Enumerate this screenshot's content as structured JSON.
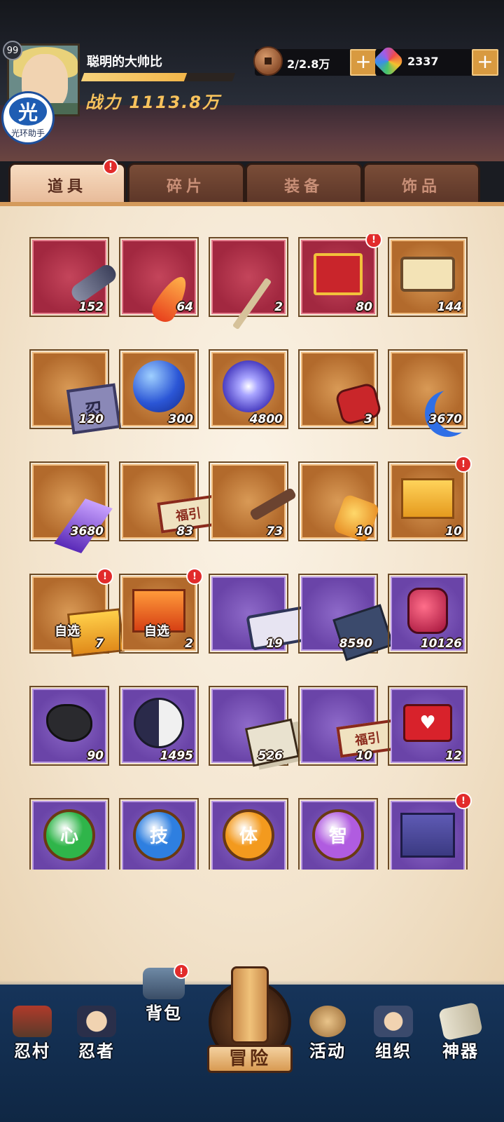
{
  "player": {
    "level": "99",
    "name": "聪明的大帅比",
    "power_label": "战力",
    "power_value": "1113.8万",
    "exp_fraction": 0.68
  },
  "helper_badge": {
    "glyph": "光",
    "label": "光环助手"
  },
  "resources": {
    "coins": {
      "icon": "copper-coin-icon",
      "value": "2/2.8万",
      "add": "+"
    },
    "gems": {
      "icon": "rainbow-gem-icon",
      "value": "2337",
      "add": "+"
    }
  },
  "tabs": [
    {
      "label": "道具",
      "active": true,
      "badge": "!"
    },
    {
      "label": "碎片",
      "active": false
    },
    {
      "label": "装备",
      "active": false
    },
    {
      "label": "饰品",
      "active": false
    }
  ],
  "items": [
    {
      "icon": "scroll-icon",
      "rarity": "red",
      "count": "152"
    },
    {
      "icon": "phoenix-feather-icon",
      "rarity": "red",
      "count": "64"
    },
    {
      "icon": "wooden-stick-icon",
      "rarity": "red",
      "count": "2"
    },
    {
      "icon": "gift-box-icon",
      "rarity": "red",
      "count": "80",
      "badge": "!"
    },
    {
      "icon": "map-scroll-icon",
      "rarity": "orange",
      "count": "144"
    },
    {
      "icon": "cloth-charm-icon",
      "rarity": "orange",
      "count": "120",
      "glyph": "忍"
    },
    {
      "icon": "blue-orb-icon",
      "rarity": "orange",
      "count": "300"
    },
    {
      "icon": "purple-orb-icon",
      "rarity": "orange",
      "count": "4800"
    },
    {
      "icon": "red-stone-icon",
      "rarity": "orange",
      "count": "3"
    },
    {
      "icon": "blue-moon-icon",
      "rarity": "orange",
      "count": "3670"
    },
    {
      "icon": "purple-crystal-icon",
      "rarity": "orange",
      "count": "3680"
    },
    {
      "icon": "fortune-banner-icon",
      "rarity": "orange",
      "count": "83",
      "glyph": "福引"
    },
    {
      "icon": "key-icon",
      "rarity": "orange",
      "count": "73"
    },
    {
      "icon": "amber-icon",
      "rarity": "orange",
      "count": "10"
    },
    {
      "icon": "gold-box-icon",
      "rarity": "orange",
      "count": "10",
      "badge": "!"
    },
    {
      "icon": "gold-chest-icon",
      "rarity": "orange",
      "count": "7",
      "tag": "自选",
      "badge": "!"
    },
    {
      "icon": "orange-chest-icon",
      "rarity": "orange",
      "count": "2",
      "tag": "自选",
      "badge": "!"
    },
    {
      "icon": "scroll-purple-icon",
      "rarity": "purple",
      "count": "19"
    },
    {
      "icon": "book-icon",
      "rarity": "purple",
      "count": "8590"
    },
    {
      "icon": "potion-jar-icon",
      "rarity": "purple",
      "count": "10126"
    },
    {
      "icon": "black-ore-icon",
      "rarity": "purple",
      "count": "90"
    },
    {
      "icon": "yin-yang-icon",
      "rarity": "purple",
      "count": "1495"
    },
    {
      "icon": "cards-icon",
      "rarity": "purple",
      "count": "526"
    },
    {
      "icon": "fortune-banner-icon",
      "rarity": "purple",
      "count": "10",
      "glyph": "福引"
    },
    {
      "icon": "medkit-icon",
      "rarity": "purple",
      "count": "12"
    },
    {
      "icon": "green-orb-icon",
      "rarity": "purple",
      "glyph": "心",
      "color": "#2fb54a"
    },
    {
      "icon": "blue-orb-icon",
      "rarity": "purple",
      "glyph": "技",
      "color": "#2e7fe0"
    },
    {
      "icon": "orange-orb-icon",
      "rarity": "purple",
      "glyph": "体",
      "color": "#f39a1e"
    },
    {
      "icon": "violet-orb-icon",
      "rarity": "purple",
      "glyph": "智",
      "color": "#b05ce0"
    },
    {
      "icon": "purple-box-icon",
      "rarity": "purple",
      "badge": "!"
    }
  ],
  "nav": [
    {
      "label": "忍村",
      "icon": "village-gate-icon"
    },
    {
      "label": "忍者",
      "icon": "ninja-icon"
    },
    {
      "label": "背包",
      "icon": "backpack-icon",
      "badge": "!"
    },
    {
      "label": "冒险",
      "icon": "adventure-scroll-icon"
    },
    {
      "label": "活动",
      "icon": "drum-icon"
    },
    {
      "label": "组织",
      "icon": "organization-icon"
    },
    {
      "label": "神器",
      "icon": "artifact-scroll-icon"
    }
  ],
  "colors": {
    "rarity_red": "#a22840",
    "rarity_orange": "#b26a2c",
    "rarity_purple": "#6a44a8",
    "badge_red": "#e22b2b",
    "power_gold": "#f7c25c"
  }
}
